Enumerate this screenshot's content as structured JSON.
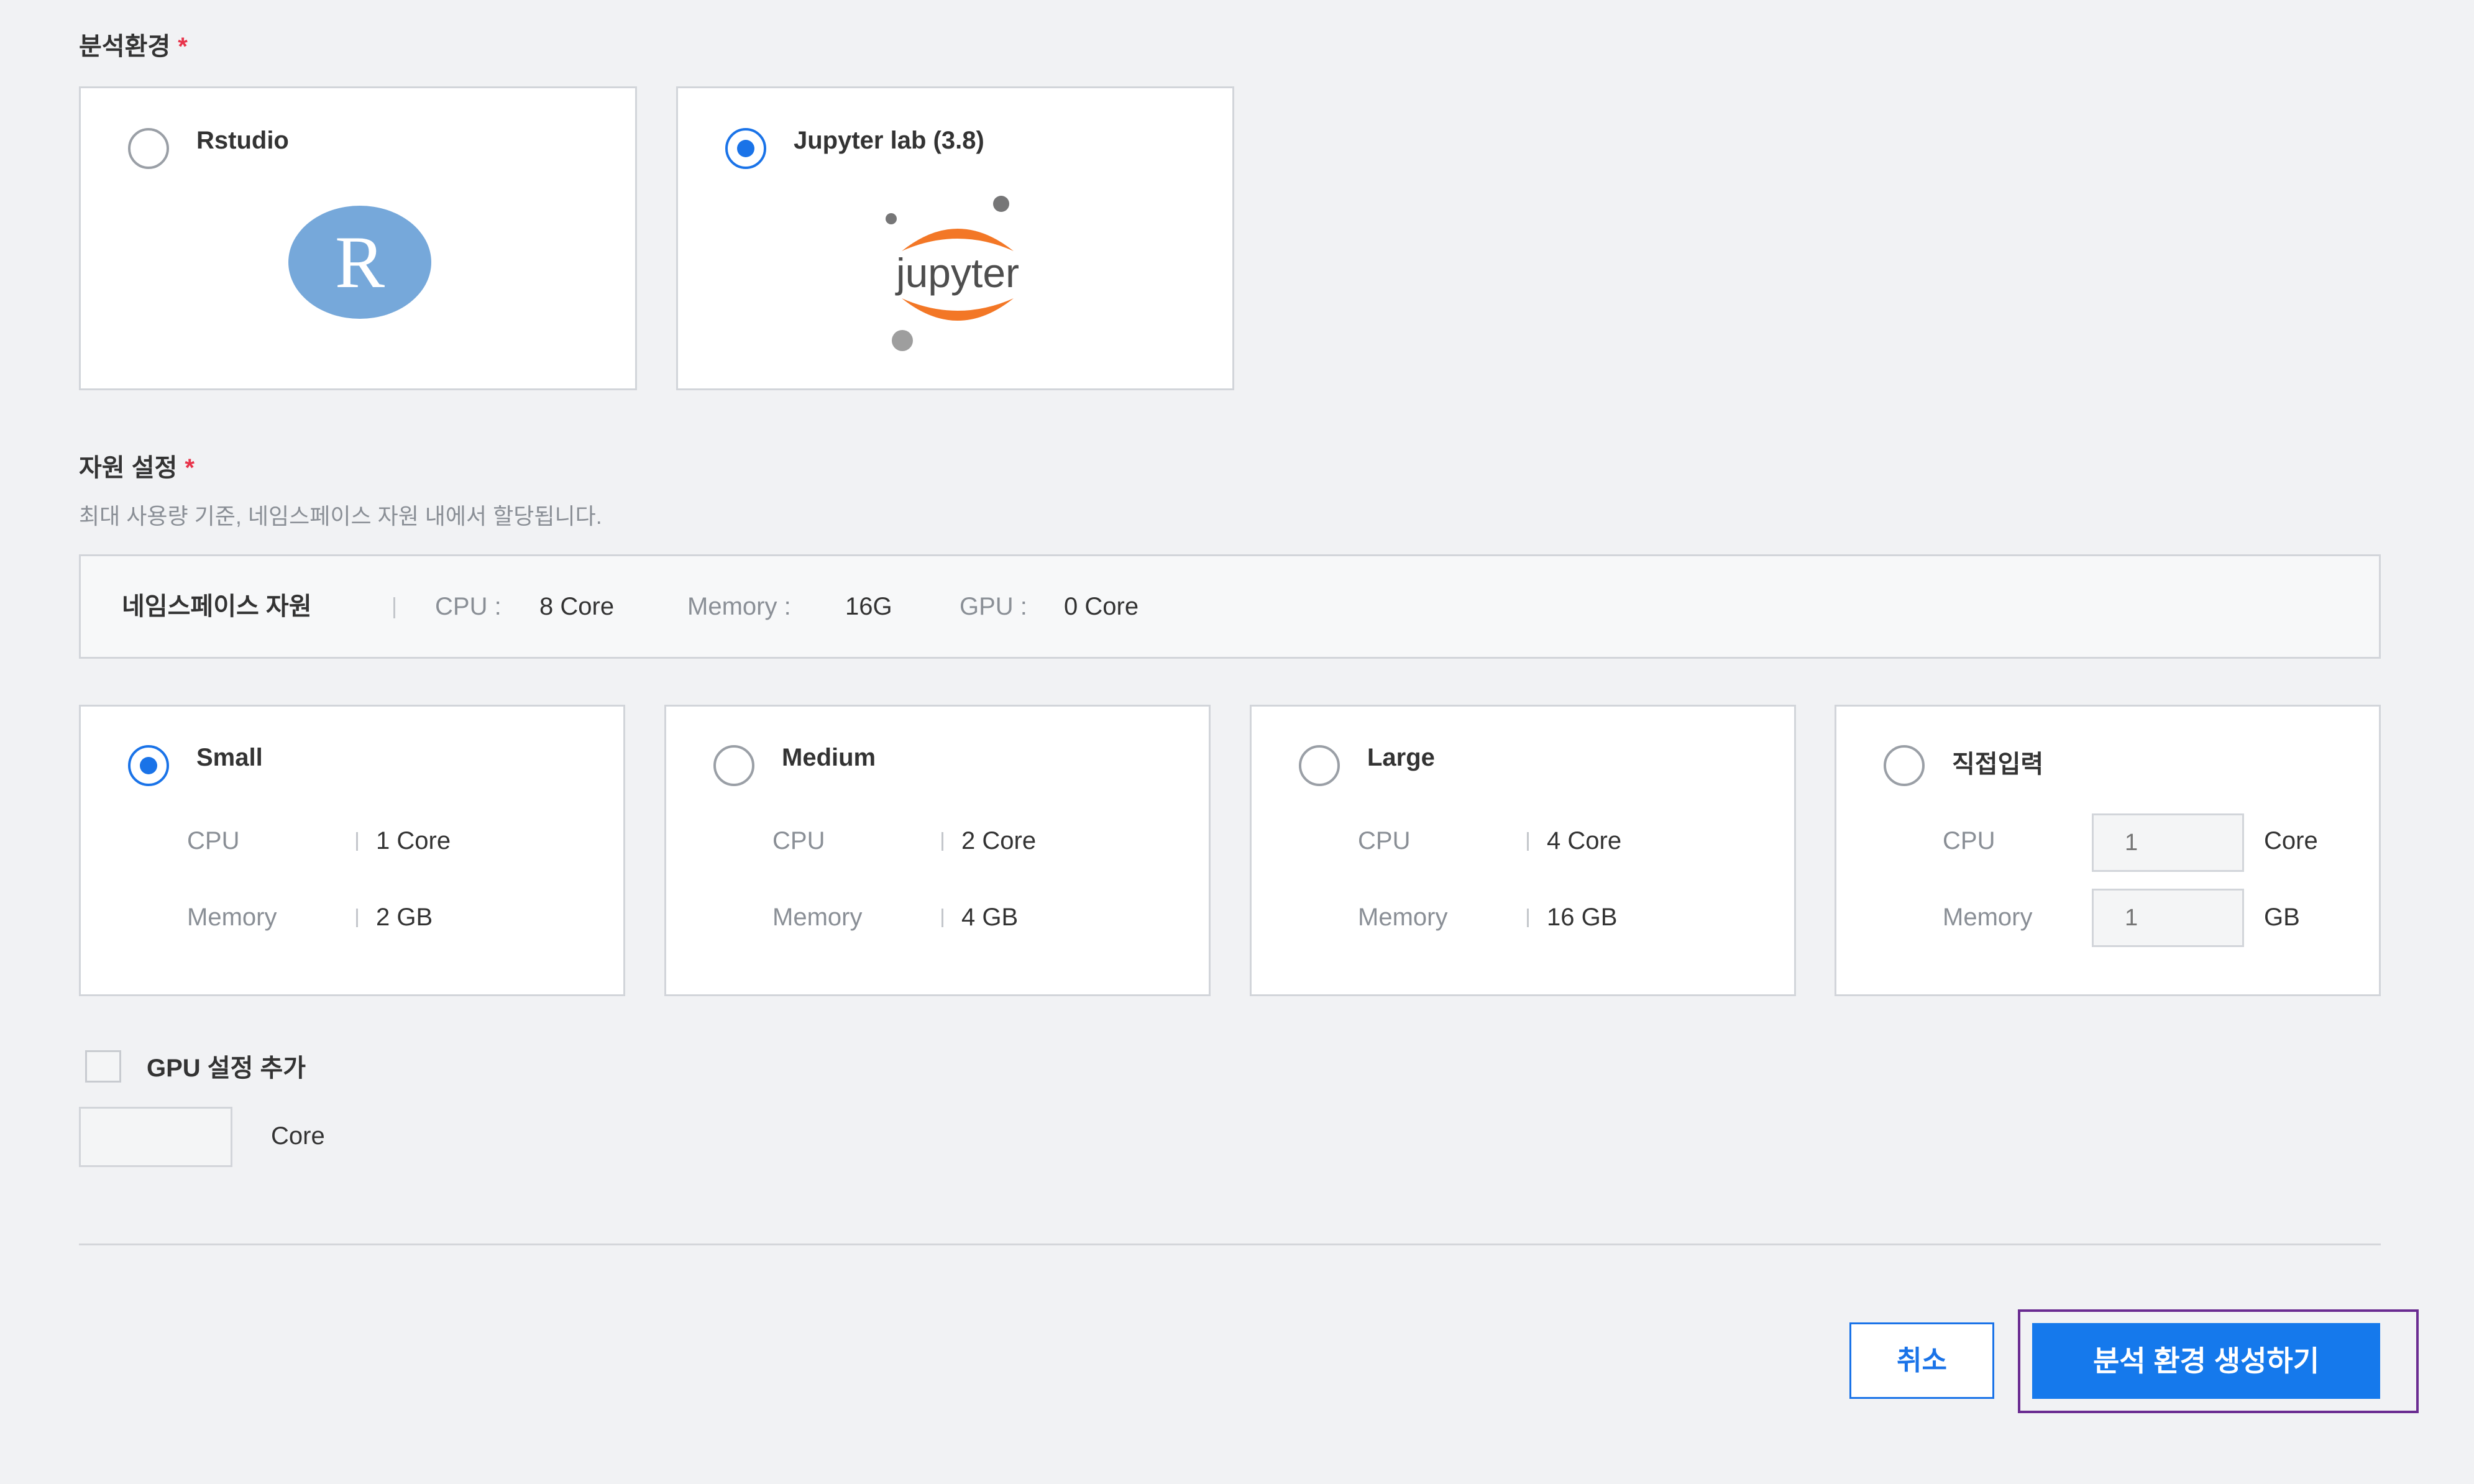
{
  "env_section": {
    "title": "분석환경",
    "required_mark": "*",
    "options": [
      {
        "label": "Rstudio",
        "selected": false,
        "logo_letter": "R"
      },
      {
        "label": "Jupyter lab (3.8)",
        "selected": true,
        "logo_text": "jupyter"
      }
    ]
  },
  "resource_section": {
    "title": "자원 설정",
    "required_mark": "*",
    "description": "최대 사용량 기준, 네임스페이스 자원 내에서 할당됩니다.",
    "namespace": {
      "label": "네임스페이스 자원",
      "cpu_key": "CPU :",
      "cpu_val": "8 Core",
      "mem_key": "Memory :",
      "mem_val": "16G",
      "gpu_key": "GPU :",
      "gpu_val": "0 Core"
    },
    "presets": [
      {
        "label": "Small",
        "selected": true,
        "cpu_key": "CPU",
        "cpu_val": "1 Core",
        "mem_key": "Memory",
        "mem_val": "2 GB"
      },
      {
        "label": "Medium",
        "selected": false,
        "cpu_key": "CPU",
        "cpu_val": "2 Core",
        "mem_key": "Memory",
        "mem_val": "4 GB"
      },
      {
        "label": "Large",
        "selected": false,
        "cpu_key": "CPU",
        "cpu_val": "4 Core",
        "mem_key": "Memory",
        "mem_val": "16 GB"
      },
      {
        "label": "직접입력",
        "selected": false,
        "cpu_key": "CPU",
        "cpu_placeholder": "1",
        "cpu_unit": "Core",
        "mem_key": "Memory",
        "mem_placeholder": "1",
        "mem_unit": "GB"
      }
    ]
  },
  "gpu": {
    "checkbox_label": "GPU 설정 추가",
    "checked": false,
    "unit": "Core",
    "value": ""
  },
  "actions": {
    "cancel_label": "취소",
    "create_label": "분석 환경 생성하기"
  },
  "colors": {
    "accent": "#1a73e8",
    "required": "#e8334a",
    "jupyter_orange": "#f37726",
    "focus": "#6a2c91"
  }
}
